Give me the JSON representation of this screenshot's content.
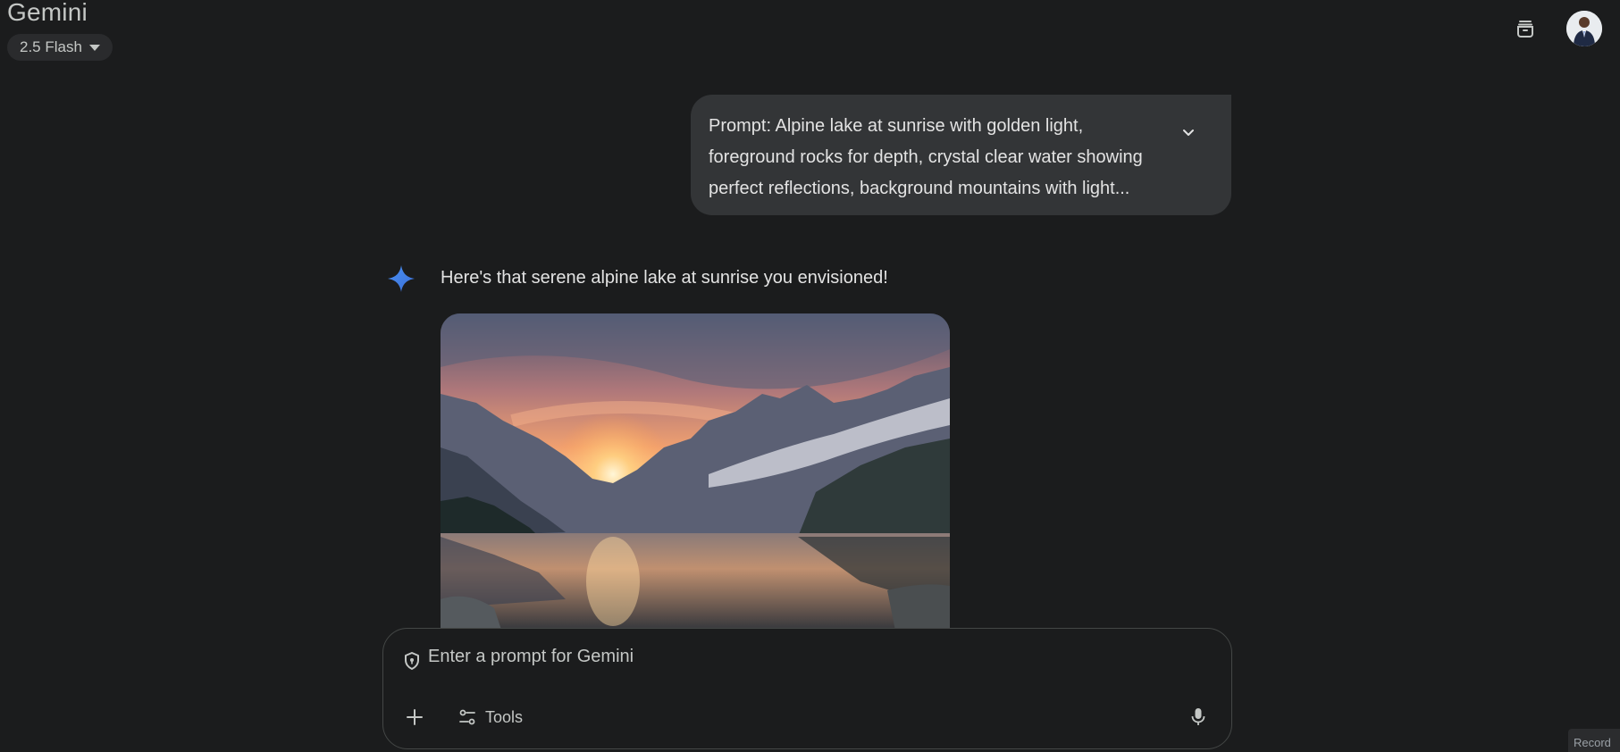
{
  "header": {
    "title": "Gemini",
    "model_label": "2.5 Flash"
  },
  "prompt": {
    "text_line1": "Prompt: Alpine lake at sunrise with golden light,",
    "text_line2": "foreground rocks for depth, crystal clear water showing",
    "text_line3": "perfect reflections, background mountains with light..."
  },
  "response": {
    "text": "Here's that serene alpine lake at sunrise you envisioned!"
  },
  "composer": {
    "placeholder": "Enter a prompt for Gemini",
    "tools_label": "Tools"
  },
  "overlay": {
    "record_label": "Record"
  },
  "icons": {
    "archive": "archive-icon",
    "expand": "chevron-down-icon",
    "spark": "gemini-spark-icon",
    "shield": "shield-icon",
    "add": "plus-icon",
    "tools": "tune-icon",
    "mic": "mic-icon"
  },
  "colors": {
    "background": "#1b1c1d",
    "bubble": "#333537",
    "accent_blue": "#4285f4"
  }
}
